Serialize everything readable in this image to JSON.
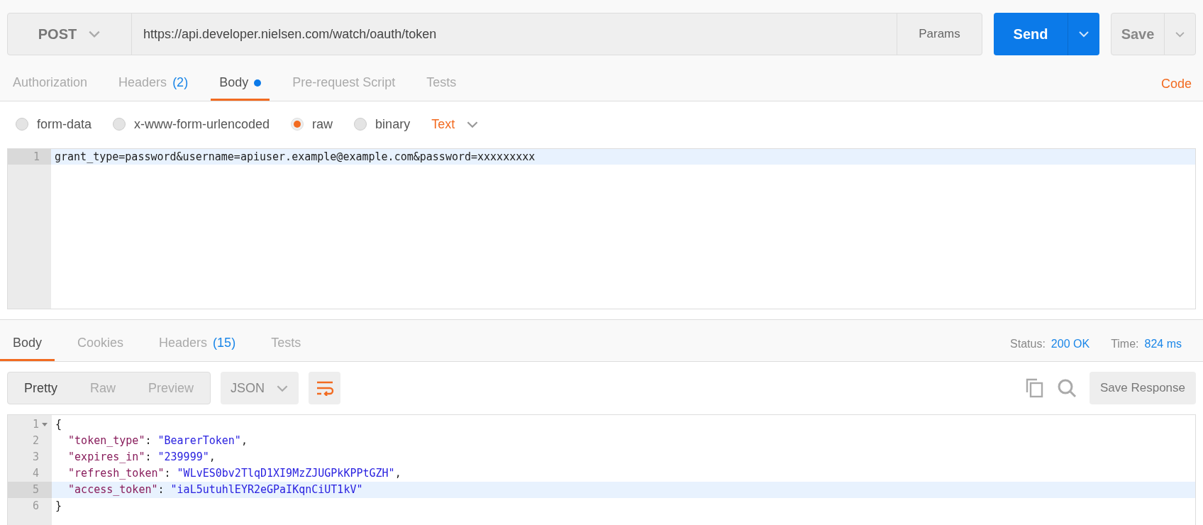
{
  "request": {
    "method": "POST",
    "url": "https://api.developer.nielsen.com/watch/oauth/token",
    "params_label": "Params",
    "send_label": "Send",
    "save_label": "Save"
  },
  "request_tabs": [
    {
      "label": "Authorization",
      "selected": false,
      "modified": false
    },
    {
      "label": "Headers",
      "count": "(2)",
      "selected": false,
      "modified": false
    },
    {
      "label": "Body",
      "selected": true,
      "modified": true
    },
    {
      "label": "Pre-request Script",
      "selected": false,
      "modified": false
    },
    {
      "label": "Tests",
      "selected": false,
      "modified": false
    }
  ],
  "code_link": "Code",
  "body_modes": [
    {
      "label": "form-data",
      "selected": false
    },
    {
      "label": "x-www-form-urlencoded",
      "selected": false
    },
    {
      "label": "raw",
      "selected": true
    },
    {
      "label": "binary",
      "selected": false
    }
  ],
  "content_type": "Text",
  "request_body": {
    "lines": [
      {
        "number": "1",
        "text": "grant_type=password&username=apiuser.example@example.com&password=xxxxxxxxx",
        "selected": true
      }
    ]
  },
  "response_tabs": [
    {
      "label": "Body",
      "selected": true
    },
    {
      "label": "Cookies",
      "selected": false
    },
    {
      "label": "Headers",
      "count": "(15)",
      "selected": false
    },
    {
      "label": "Tests",
      "selected": false
    }
  ],
  "status": {
    "label": "Status:",
    "value": "200 OK"
  },
  "time": {
    "label": "Time:",
    "value": "824 ms"
  },
  "view_modes": [
    {
      "label": "Pretty",
      "selected": true
    },
    {
      "label": "Raw",
      "selected": false
    },
    {
      "label": "Preview",
      "selected": false
    }
  ],
  "format": "JSON",
  "save_response_label": "Save Response",
  "response_body": {
    "lines": [
      {
        "number": "1",
        "foldable": true,
        "selected": false,
        "segments": [
          {
            "kind": "punct",
            "text": "{"
          }
        ]
      },
      {
        "number": "2",
        "foldable": false,
        "selected": false,
        "segments": [
          {
            "kind": "key",
            "text": "  \"token_type\""
          },
          {
            "kind": "punct",
            "text": ": "
          },
          {
            "kind": "string",
            "text": "\"BearerToken\""
          },
          {
            "kind": "punct",
            "text": ","
          }
        ]
      },
      {
        "number": "3",
        "foldable": false,
        "selected": false,
        "segments": [
          {
            "kind": "key",
            "text": "  \"expires_in\""
          },
          {
            "kind": "punct",
            "text": ": "
          },
          {
            "kind": "string",
            "text": "\"239999\""
          },
          {
            "kind": "punct",
            "text": ","
          }
        ]
      },
      {
        "number": "4",
        "foldable": false,
        "selected": false,
        "segments": [
          {
            "kind": "key",
            "text": "  \"refresh_token\""
          },
          {
            "kind": "punct",
            "text": ": "
          },
          {
            "kind": "string",
            "text": "\"WLvES0bv2TlqD1XI9MzZJUGPkKPPtGZH\""
          },
          {
            "kind": "punct",
            "text": ","
          }
        ]
      },
      {
        "number": "5",
        "foldable": false,
        "selected": true,
        "segments": [
          {
            "kind": "key",
            "text": "  \"access_token\""
          },
          {
            "kind": "punct",
            "text": ": "
          },
          {
            "kind": "string",
            "text": "\"iaL5utuhlEYR2eGPaIKqnCiUT1kV\""
          }
        ]
      },
      {
        "number": "6",
        "foldable": false,
        "selected": false,
        "segments": [
          {
            "kind": "punct",
            "text": "}"
          }
        ]
      }
    ]
  }
}
